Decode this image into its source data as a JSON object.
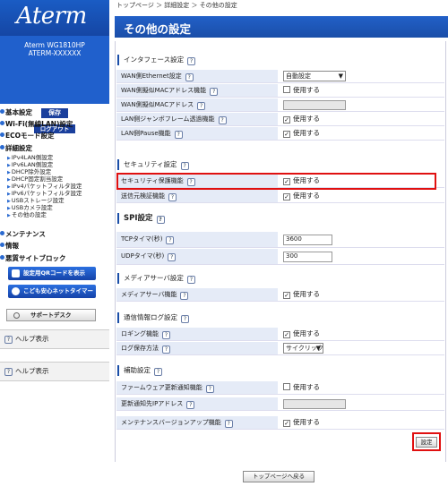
{
  "logo": "Aterm",
  "device": {
    "model": "Aterm WG1810HP",
    "name": "ATERM-XXXXXX"
  },
  "sidebar": {
    "save_label": "保存",
    "logout_label": "ログアウト",
    "nav": [
      {
        "label": "基本設定"
      },
      {
        "label": "Wi-Fi(無線LAN)設定"
      },
      {
        "label": "ECOモード設定"
      },
      {
        "label": "詳細設定"
      }
    ],
    "sub_items": [
      "IPv4LAN側設定",
      "IPv6LAN側設定",
      "DHCP除外設定",
      "DHCP固定割当設定",
      "IPv4パケットフィルタ設定",
      "IPv6パケットフィルタ設定",
      "USBストレージ設定",
      "USBカメラ設定",
      "その他の設定"
    ],
    "nav2": [
      {
        "label": "メンテナンス"
      },
      {
        "label": "情報"
      },
      {
        "label": "悪質サイトブロック"
      }
    ],
    "qr_button": "設定用QRコードを表示",
    "kids_button": "こども安心ネットタイマー",
    "support_button": "サポートデスク",
    "help1": "ヘルプ表示",
    "help2": "ヘルプ表示"
  },
  "breadcrumb": "トップページ ＞ 詳細設定 ＞ その他の設定",
  "page_title": "その他の設定",
  "help_glyph": "?",
  "sections": {
    "interface": {
      "title": "インタフェース設定",
      "rows": [
        {
          "label": "WAN側Ethernet設定",
          "value": "自動設定"
        },
        {
          "label": "WAN側擬似MACアドレス機能",
          "value": "使用する"
        },
        {
          "label": "WAN側擬似MACアドレス",
          "value": ""
        },
        {
          "label": "LAN側ジャンボフレーム透過機能",
          "value": "使用する"
        },
        {
          "label": "LAN側Pause機能",
          "value": "使用する"
        }
      ]
    },
    "security": {
      "title": "セキュリティ設定",
      "rows": [
        {
          "label": "セキュリティ保護機能",
          "value": "使用する"
        },
        {
          "label": "送信元検証機能",
          "value": "使用する"
        }
      ]
    },
    "spi": {
      "title": "SPI設定",
      "rows": [
        {
          "label": "TCPタイマ(秒)",
          "value": "3600"
        },
        {
          "label": "UDPタイマ(秒)",
          "value": "300"
        }
      ]
    },
    "media": {
      "title": "メディアサーバ設定",
      "rows": [
        {
          "label": "メディアサーバ機能",
          "value": "使用する"
        }
      ]
    },
    "log": {
      "title": "通信情報ログ設定",
      "rows": [
        {
          "label": "ロギング機能",
          "value": "使用する"
        },
        {
          "label": "ログ保存方法",
          "value": "サイクリック"
        }
      ]
    },
    "aux": {
      "title": "補助設定",
      "rows": [
        {
          "label": "ファームウェア更新通知機能",
          "value": "使用する"
        },
        {
          "label": "更新通知先IPアドレス",
          "value": ""
        },
        {
          "label": "メンテナンスバージョンアップ機能",
          "value": "使用する"
        }
      ]
    }
  },
  "apply_label": "設定",
  "back_label": "トップページへ戻る",
  "colors": {
    "header_blue": "#1a4ea8",
    "label_bg": "#e5ebf7",
    "highlight": "#e01010"
  }
}
